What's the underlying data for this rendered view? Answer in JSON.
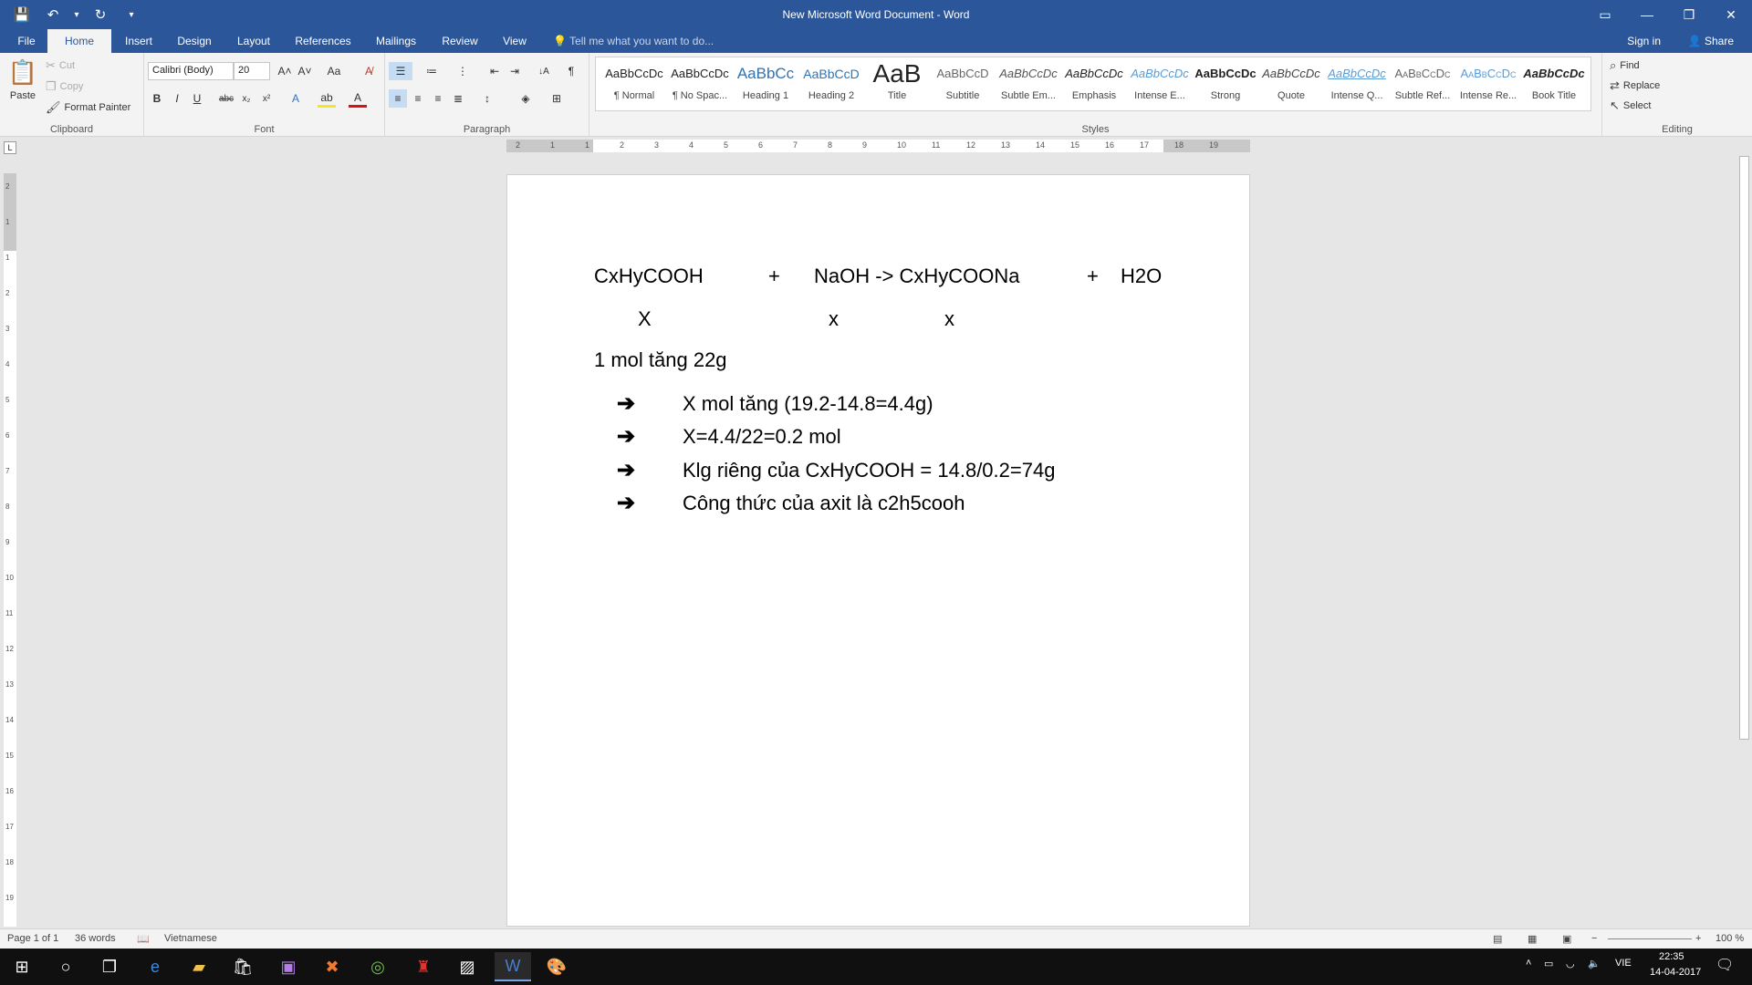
{
  "window": {
    "title": "New Microsoft Word Document - Word",
    "controls": {
      "ribbon_display": "▭",
      "minimize": "—",
      "restore": "❐",
      "close": "✕"
    }
  },
  "qat": {
    "save": "💾",
    "undo": "↶",
    "undo_dd": "▾",
    "redo": "↻",
    "customize": "▾"
  },
  "tabs": [
    "File",
    "Home",
    "Insert",
    "Design",
    "Layout",
    "References",
    "Mailings",
    "Review",
    "View"
  ],
  "active_tab": "Home",
  "tell_me": "Tell me what you want to do...",
  "account": {
    "sign_in": "Sign in",
    "share": "Share"
  },
  "ribbon": {
    "clipboard": {
      "label": "Clipboard",
      "paste": "Paste",
      "cut": "Cut",
      "copy": "Copy",
      "format_painter": "Format Painter"
    },
    "font": {
      "label": "Font",
      "font_name": "Calibri (Body)",
      "font_size": "20",
      "grow": "A˄",
      "shrink": "A˅",
      "change_case": "Aa",
      "clear": "A̸",
      "bold": "B",
      "italic": "I",
      "underline": "U",
      "strike": "abc",
      "subscript": "x₂",
      "superscript": "x²",
      "text_effects": "A",
      "highlight": "ab",
      "font_color": "A"
    },
    "paragraph": {
      "label": "Paragraph",
      "bullets": "☰",
      "numbering": "≔",
      "multilevel": "⋮",
      "decrease_indent": "⇤",
      "increase_indent": "⇥",
      "sort": "↓A",
      "show_marks": "¶"
    },
    "styles": {
      "label": "Styles",
      "items": [
        {
          "preview": "AaBbCcDc",
          "name": "¶ Normal"
        },
        {
          "preview": "AaBbCcDc",
          "name": "¶ No Spac..."
        },
        {
          "preview": "AaBbCc",
          "name": "Heading 1"
        },
        {
          "preview": "AaBbCcD",
          "name": "Heading 2"
        },
        {
          "preview": "AaB",
          "name": "Title"
        },
        {
          "preview": "AaBbCcD",
          "name": "Subtitle"
        },
        {
          "preview": "AaBbCcDc",
          "name": "Subtle Em..."
        },
        {
          "preview": "AaBbCcDc",
          "name": "Emphasis"
        },
        {
          "preview": "AaBbCcDc",
          "name": "Intense E..."
        },
        {
          "preview": "AaBbCcDc",
          "name": "Strong"
        },
        {
          "preview": "AaBbCcDc",
          "name": "Quote"
        },
        {
          "preview": "AaBbCcDc",
          "name": "Intense Q..."
        },
        {
          "preview": "AaBbCcDc",
          "name": "Subtle Ref..."
        },
        {
          "preview": "AaBbCcDc",
          "name": "Intense Re..."
        },
        {
          "preview": "AaBbCcDc",
          "name": "Book Title"
        }
      ]
    },
    "editing": {
      "label": "Editing",
      "find": "Find",
      "replace": "Replace",
      "select": "Select"
    }
  },
  "ruler": {
    "h_ticks": [
      "2",
      "1",
      "1",
      "2",
      "3",
      "4",
      "5",
      "6",
      "7",
      "8",
      "9",
      "10",
      "11",
      "12",
      "13",
      "14",
      "15",
      "16",
      "17",
      "18",
      "19"
    ],
    "v_ticks": [
      "2",
      "1",
      "1",
      "2",
      "3",
      "4",
      "5",
      "6",
      "7",
      "8",
      "9",
      "10",
      "11",
      "12",
      "13",
      "14",
      "15",
      "16",
      "17",
      "18",
      "19"
    ],
    "corner": "L"
  },
  "document": {
    "eq_line": [
      "CxHyCOOH",
      "+",
      "NaOH -> CxHyCOONa",
      "+",
      "H2O"
    ],
    "mol_line": [
      "X",
      "x",
      "x"
    ],
    "line3": "1 mol tăng 22g",
    "bullets": [
      "X mol tăng (19.2-14.8=4.4g)",
      "X=4.4/22=0.2 mol",
      "Klg riêng của CxHyCOOH = 14.8/0.2=74g",
      "Công thức của axit là c2h5cooh"
    ],
    "bullet_glyph": "➔"
  },
  "status": {
    "page": "Page 1 of 1",
    "words": "36 words",
    "language": "Vietnamese",
    "zoom": "100 %"
  },
  "taskbar": {
    "language": "VIE",
    "time": "22:35",
    "date": "14-04-2017"
  }
}
